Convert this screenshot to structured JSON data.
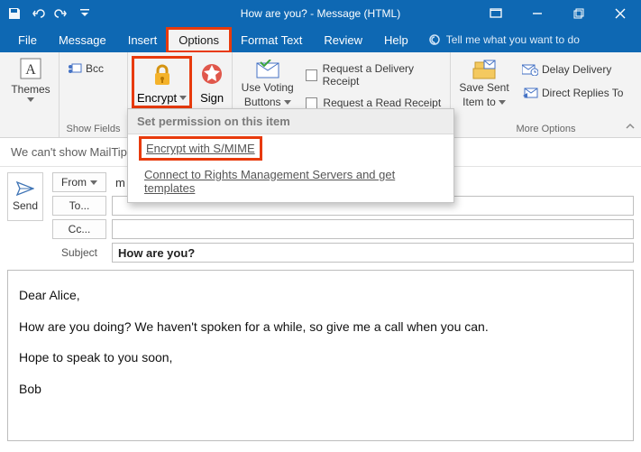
{
  "title": "How are you?  -  Message (HTML)",
  "menu": {
    "file": "File",
    "message": "Message",
    "insert": "Insert",
    "options": "Options",
    "format_text": "Format Text",
    "review": "Review",
    "help": "Help",
    "tellme": "Tell me what you want to do"
  },
  "ribbon": {
    "themes": "Themes",
    "bcc": "Bcc",
    "show_fields": "Show Fields",
    "encrypt": "Encrypt",
    "sign": "Sign",
    "voting_line1": "Use Voting",
    "voting_line2": "Buttons",
    "delivery_receipt": "Request a Delivery Receipt",
    "read_receipt": "Request a Read Receipt",
    "save_sent_line1": "Save Sent",
    "save_sent_line2": "Item to",
    "delay_delivery": "Delay Delivery",
    "direct_replies": "Direct Replies To",
    "more_options": "More Options"
  },
  "dropdown": {
    "header": "Set permission on this item",
    "item1": "Encrypt with S/MIME",
    "item2": "Connect to Rights Management Servers and get templates"
  },
  "mailtip": "We can't show MailTip",
  "compose": {
    "send": "Send",
    "from": "From",
    "from_value": "m",
    "to": "To...",
    "cc": "Cc...",
    "subject_label": "Subject",
    "subject_value": "How are you?"
  },
  "body": {
    "l1": "Dear Alice,",
    "l2": "How are you doing? We haven't spoken for a while, so give me a call when you can.",
    "l3": "Hope to speak to you soon,",
    "l4": "Bob"
  }
}
